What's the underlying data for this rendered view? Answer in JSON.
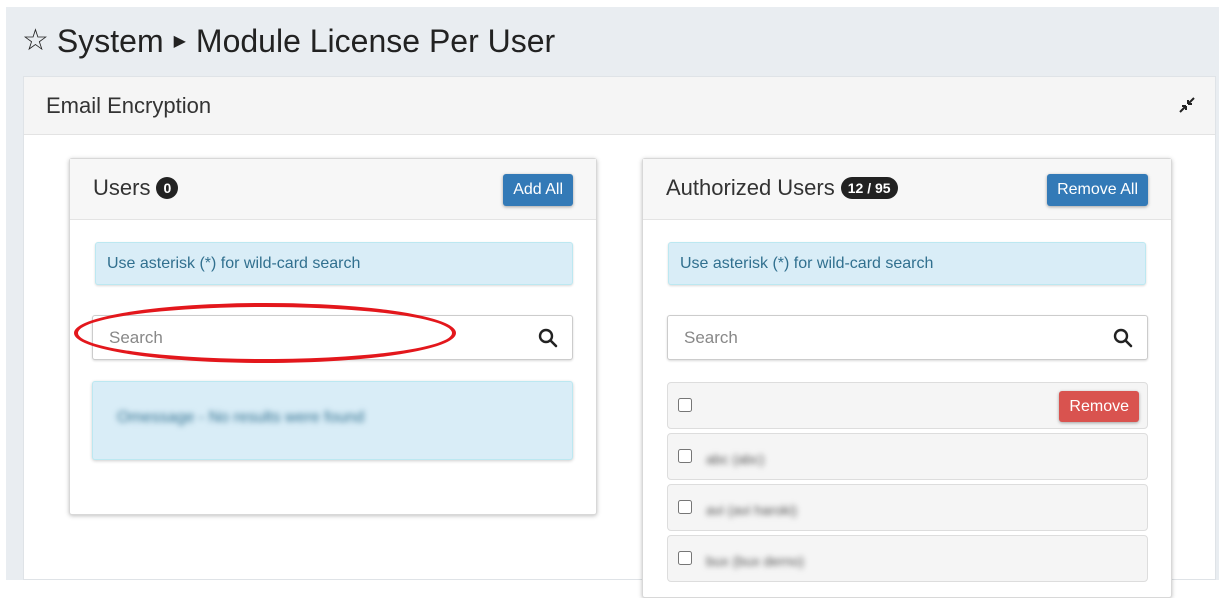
{
  "breadcrumb": {
    "star_icon": "star-outline-icon",
    "section": "System",
    "separator_icon": "caret-right-icon",
    "page": "Module License Per User"
  },
  "panel": {
    "title": "Email Encryption",
    "collapse_icon": "compress-arrows-icon"
  },
  "users": {
    "title": "Users",
    "count": "0",
    "add_all_label": "Add All",
    "hint": "Use asterisk (*) for wild-card search",
    "search_placeholder": "Search",
    "empty_message": "Omessage - No results were found"
  },
  "authorized": {
    "title": "Authorized Users",
    "count": "12 / 95",
    "remove_all_label": "Remove All",
    "hint": "Use asterisk (*) for wild-card search",
    "search_placeholder": "Search",
    "remove_label": "Remove",
    "rows": [
      {
        "name": ""
      },
      {
        "name": "abc (abc)"
      },
      {
        "name": "avi (avi haroki)"
      },
      {
        "name": "bux (bux derno)"
      }
    ]
  },
  "colors": {
    "primary": "#337ab7",
    "danger": "#d9534f",
    "info_bg": "#d9edf7",
    "info_text": "#31708f",
    "annotation": "#e3171c"
  }
}
